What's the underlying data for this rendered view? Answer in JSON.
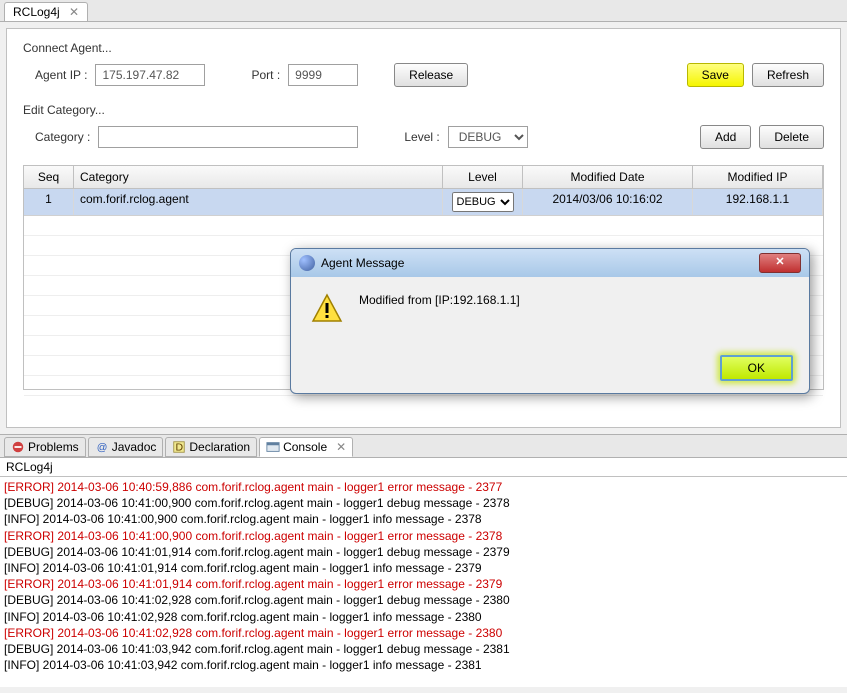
{
  "topTab": {
    "label": "RCLog4j"
  },
  "connectAgent": {
    "sectionLabel": "Connect Agent...",
    "ipLabel": "Agent IP :",
    "ipValue": "175.197.47.82",
    "portLabel": "Port :",
    "portValue": "9999",
    "releaseBtn": "Release",
    "saveBtn": "Save",
    "refreshBtn": "Refresh"
  },
  "editCategory": {
    "sectionLabel": "Edit Category...",
    "categoryLabel": "Category :",
    "categoryValue": "",
    "levelLabel": "Level :",
    "levelValue": "DEBUG",
    "addBtn": "Add",
    "deleteBtn": "Delete"
  },
  "table": {
    "headers": {
      "seq": "Seq",
      "category": "Category",
      "level": "Level",
      "date": "Modified Date",
      "ip": "Modified IP"
    },
    "rows": [
      {
        "seq": "1",
        "category": "com.forif.rclog.agent",
        "level": "DEBUG",
        "date": "2014/03/06 10:16:02",
        "ip": "192.168.1.1"
      }
    ]
  },
  "bottomTabs": {
    "problems": "Problems",
    "javadoc": "Javadoc",
    "declaration": "Declaration",
    "console": "Console"
  },
  "subTitle": "RCLog4j",
  "consoleLines": [
    {
      "cls": "error",
      "text": "[ERROR] 2014-03-06 10:40:59,886 com.forif.rclog.agent main - logger1 error message - 2377"
    },
    {
      "cls": "normal",
      "text": "[DEBUG] 2014-03-06 10:41:00,900 com.forif.rclog.agent main - logger1 debug message - 2378"
    },
    {
      "cls": "normal",
      "text": "[INFO] 2014-03-06 10:41:00,900 com.forif.rclog.agent main - logger1 info message - 2378"
    },
    {
      "cls": "error",
      "text": "[ERROR] 2014-03-06 10:41:00,900 com.forif.rclog.agent main - logger1 error message - 2378"
    },
    {
      "cls": "normal",
      "text": "[DEBUG] 2014-03-06 10:41:01,914 com.forif.rclog.agent main - logger1 debug message - 2379"
    },
    {
      "cls": "normal",
      "text": "[INFO] 2014-03-06 10:41:01,914 com.forif.rclog.agent main - logger1 info message - 2379"
    },
    {
      "cls": "error",
      "text": "[ERROR] 2014-03-06 10:41:01,914 com.forif.rclog.agent main - logger1 error message - 2379"
    },
    {
      "cls": "normal",
      "text": "[DEBUG] 2014-03-06 10:41:02,928 com.forif.rclog.agent main - logger1 debug message - 2380"
    },
    {
      "cls": "normal",
      "text": "[INFO] 2014-03-06 10:41:02,928 com.forif.rclog.agent main - logger1 info message - 2380"
    },
    {
      "cls": "error",
      "text": "[ERROR] 2014-03-06 10:41:02,928 com.forif.rclog.agent main - logger1 error message - 2380"
    },
    {
      "cls": "normal",
      "text": "[DEBUG] 2014-03-06 10:41:03,942 com.forif.rclog.agent main - logger1 debug message - 2381"
    },
    {
      "cls": "normal",
      "text": "[INFO] 2014-03-06 10:41:03,942 com.forif.rclog.agent main - logger1 info message - 2381"
    }
  ],
  "dialog": {
    "title": "Agent Message",
    "body": "Modified from [IP:192.168.1.1]",
    "okBtn": "OK"
  }
}
